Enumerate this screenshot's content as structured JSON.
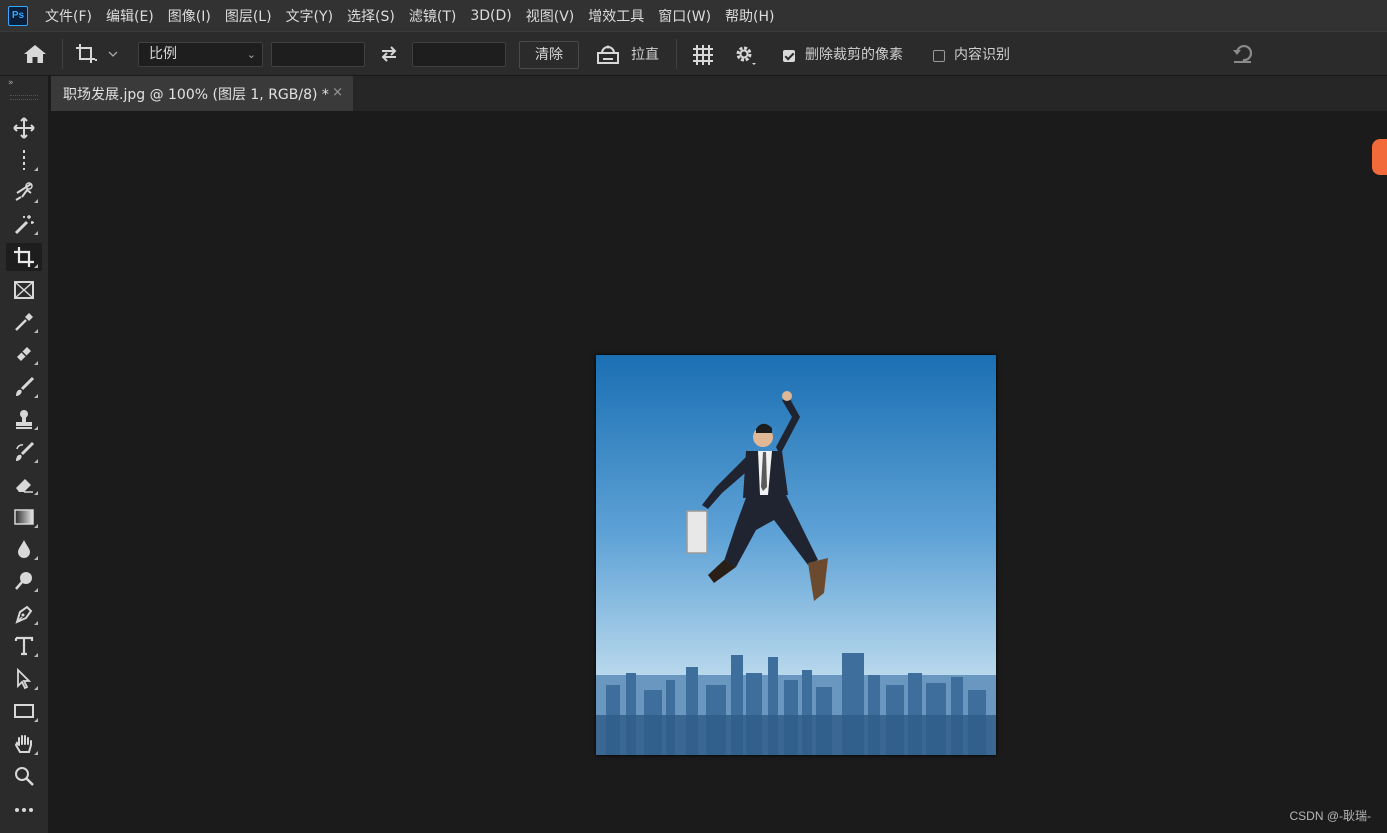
{
  "menubar": {
    "logo": "Ps",
    "items": [
      "文件(F)",
      "编辑(E)",
      "图像(I)",
      "图层(L)",
      "文字(Y)",
      "选择(S)",
      "滤镜(T)",
      "3D(D)",
      "视图(V)",
      "增效工具",
      "窗口(W)",
      "帮助(H)"
    ]
  },
  "options": {
    "ratio_label": "比例",
    "width_value": "",
    "height_value": "",
    "clear_label": "清除",
    "straighten_label": "拉直",
    "delete_cropped_label": "删除裁剪的像素",
    "delete_cropped_checked": true,
    "content_aware_label": "内容识别",
    "content_aware_checked": false
  },
  "toolbar": {
    "expand_glyph": "»",
    "tools": [
      "move",
      "marquee",
      "lasso",
      "magic-wand",
      "crop",
      "frame",
      "eyedropper",
      "healing",
      "brush",
      "stamp",
      "history-brush",
      "eraser",
      "gradient",
      "blur",
      "dodge",
      "pen",
      "type",
      "path-selection",
      "rectangle",
      "hand",
      "zoom",
      "more"
    ],
    "active": "crop"
  },
  "document": {
    "tab_title": "职场发展.jpg @ 100% (图层 1, RGB/8) *",
    "close_glyph": "×"
  },
  "watermark": "CSDN @-耿瑞-",
  "colors": {
    "menubar_bg": "#323232",
    "panel_bg": "#2b2b2b",
    "canvas_bg": "#1b1b1b",
    "sky_top": "#1a6fb3",
    "sky_bottom": "#b8d8ec",
    "badge": "#f26a3a"
  }
}
